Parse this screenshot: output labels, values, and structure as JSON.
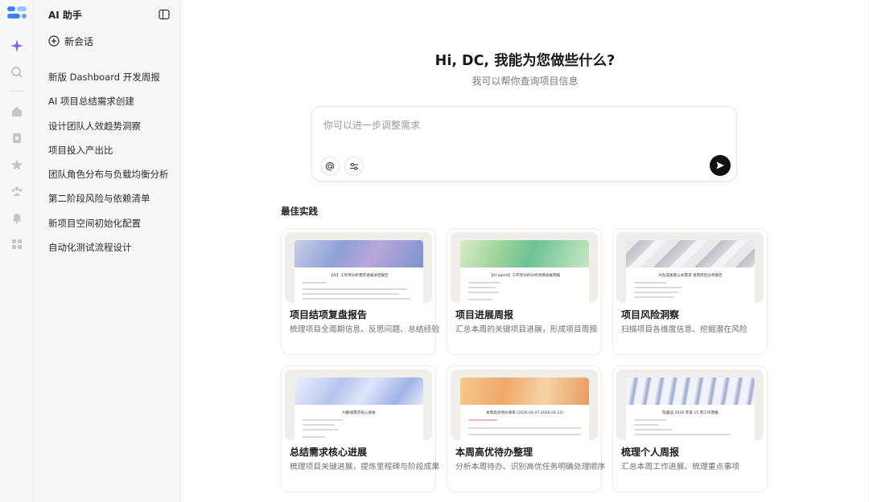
{
  "sidebar": {
    "title": "AI 助手",
    "new_chat_label": "新会话",
    "history": [
      "新版 Dashboard 开发周报",
      "AI 项目总结需求创建",
      "设计团队人效趋势洞察",
      "项目投入产出比",
      "团队角色分布与负载均衡分析",
      "第二阶段风险与依赖清单",
      "新项目空间初始化配置",
      "自动化测试流程设计"
    ]
  },
  "main": {
    "greeting": "Hi, DC, 我能为您做些什么?",
    "subtitle": "我可以帮你查询项目信息",
    "composer": {
      "placeholder": "你可以进一步调整需求"
    },
    "section_title": "最佳实践",
    "cards": [
      {
        "title": "项目结项复盘报告",
        "desc": "梳理项目全周期信息、反思问题、总结经验",
        "doc_title": "【AI】工作项分析需求进展总结报告"
      },
      {
        "title": "项目进展周报",
        "desc": "汇总本周的关键项目进展，形成项目周报",
        "doc_title": "【AI agent】工作项分析分析项目进展周报"
      },
      {
        "title": "项目风险洞察",
        "desc": "扫描项目各维度信息、挖掘潜在风险",
        "doc_title": "AI生成质量公式需求 逐周风险分析报告"
      },
      {
        "title": "总结需求核心进展",
        "desc": "梳理项目关键进展，提炼里程碑与阶段成果",
        "doc_title": "AI翻译需求核心进展"
      },
      {
        "title": "本周高优待办整理",
        "desc": "分析本周待办、识别高优任务明确处理顺序",
        "doc_title": "本周高优待办清单 (2026.04.07-2026.04.13)"
      },
      {
        "title": "梳理个人周报",
        "desc": "汇总本周工作进展、梳理重点事项",
        "doc_title": "陈童战 2026 年第 15 周工作周报"
      }
    ]
  },
  "colors": {
    "accent_purple": "#8b5cf6",
    "send_button": "#111111",
    "logo_blue": "#3b82f6"
  },
  "icons": {
    "rail": [
      "app-logo-icon",
      "sparkle-icon",
      "search-icon",
      "home-icon",
      "document-icon",
      "star-icon",
      "team-icon",
      "bell-icon",
      "apps-grid-icon"
    ],
    "composer": [
      "at-mention-icon",
      "settings-sliders-icon",
      "send-arrow-icon"
    ]
  }
}
